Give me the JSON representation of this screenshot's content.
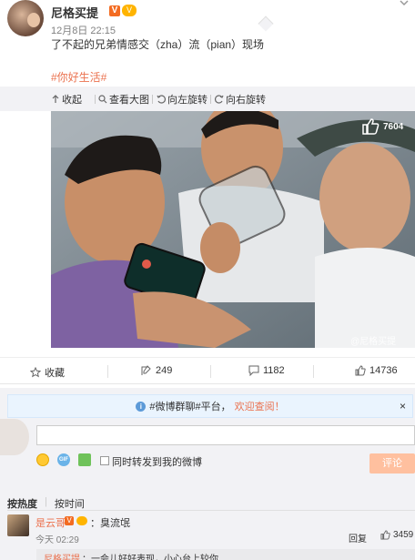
{
  "post": {
    "user_name": "尼格买提",
    "v_badge": "V",
    "vip_badge": "V",
    "time": "12月8日 22:15",
    "text": "了不起的兄弟情感交（zha）流（pian）现场",
    "hashtag": "#你好生活#",
    "close_icon": "×"
  },
  "image_toolbar": {
    "collapse_label": "收起",
    "view_large_label": "查看大图",
    "rotate_left_label": "向左旋转",
    "rotate_right_label": "向右旋转"
  },
  "photo": {
    "like_count": "7604",
    "watermark": "@尼格买提"
  },
  "action_bar": {
    "favorite_label": "收藏",
    "repost_count": "249",
    "comment_count": "1182",
    "like_count": "14736"
  },
  "notice": {
    "icon_glyph": "i",
    "text": "#微博群聊#平台，",
    "highlight": "欢迎查阅！",
    "close": "×"
  },
  "composer": {
    "gif_label": "GIF",
    "repost_checkbox_label": "同时转发到我的微博",
    "submit_label": "评论"
  },
  "sort": {
    "by_hot": "按热度",
    "by_time": "按时间"
  },
  "comments": [
    {
      "name": "是云哥",
      "v_badge": "V",
      "text": "：臭流氓",
      "time": "今天 02:29",
      "reply_label": "回复",
      "like_count": "3459",
      "sub_reply_name": "尼格买提",
      "sub_reply_text": "：一会儿好好表现，小心台上较你"
    }
  ],
  "colors": {
    "accent": "#eb7350",
    "badge_orange": "#f36b21",
    "vip_gold": "#ffb400",
    "notice_bg": "#eaf4fe",
    "panel_bg": "#f2f2f5"
  }
}
